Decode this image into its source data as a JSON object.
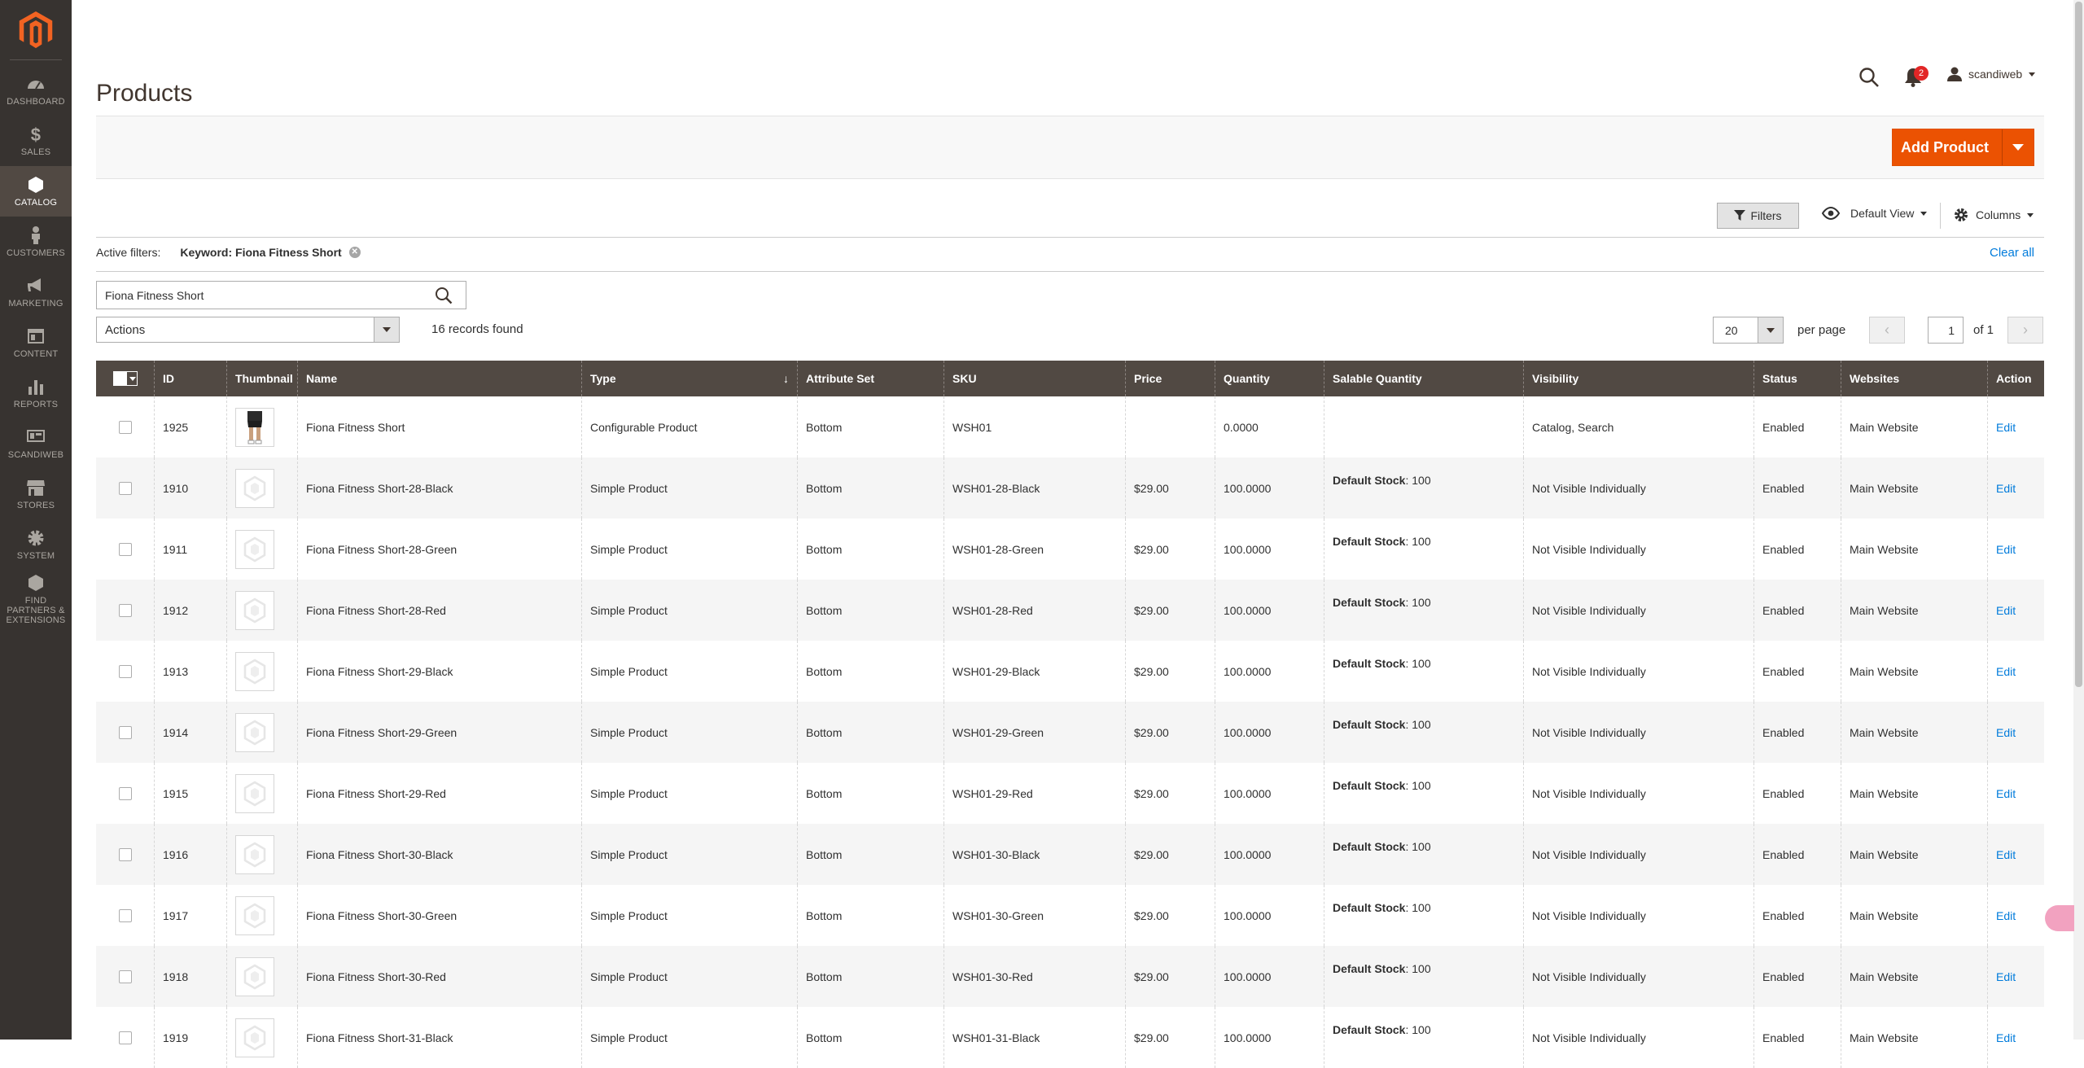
{
  "sidebar": {
    "items": [
      {
        "label": "DASHBOARD",
        "icon": "dashboard-icon"
      },
      {
        "label": "SALES",
        "icon": "dollar-icon"
      },
      {
        "label": "CATALOG",
        "icon": "box-icon",
        "active": true
      },
      {
        "label": "CUSTOMERS",
        "icon": "person-icon"
      },
      {
        "label": "MARKETING",
        "icon": "megaphone-icon"
      },
      {
        "label": "CONTENT",
        "icon": "layout-icon"
      },
      {
        "label": "REPORTS",
        "icon": "bar-chart-icon"
      },
      {
        "label": "SCANDIWEB",
        "icon": "monitor-icon"
      },
      {
        "label": "STORES",
        "icon": "store-icon"
      },
      {
        "label": "SYSTEM",
        "icon": "gear-icon"
      },
      {
        "label": "FIND PARTNERS & EXTENSIONS",
        "icon": "cube-icon"
      }
    ]
  },
  "header": {
    "title": "Products",
    "notifications_count": "2",
    "username": "scandiweb"
  },
  "toolbar": {
    "add_product_label": "Add Product",
    "filters_label": "Filters",
    "view_label": "Default View",
    "columns_label": "Columns",
    "active_filters_label": "Active filters:",
    "active_filter_chip": "Keyword: Fiona Fitness Short",
    "clear_all_label": "Clear all",
    "search_value": "Fiona Fitness Short",
    "actions_label": "Actions",
    "records_found": "16 records found",
    "per_page_value": "20",
    "per_page_label": "per page",
    "page_value": "1",
    "page_of": "of 1"
  },
  "colors": {
    "sidebar_bg": "#373330",
    "accent": "#eb5202",
    "grid_header": "#514943",
    "link": "#007bdb"
  },
  "grid": {
    "columns": [
      "ID",
      "Thumbnail",
      "Name",
      "Type",
      "Attribute Set",
      "SKU",
      "Price",
      "Quantity",
      "Salable Quantity",
      "Visibility",
      "Status",
      "Websites",
      "Action"
    ],
    "rows": [
      {
        "id": "1925",
        "name": "Fiona Fitness Short",
        "type": "Configurable Product",
        "attr": "Bottom",
        "sku": "WSH01",
        "price": "",
        "qty": "0.0000",
        "salable_label": "",
        "salable_value": "",
        "visibility": "Catalog, Search",
        "status": "Enabled",
        "website": "Main Website",
        "action": "Edit"
      },
      {
        "id": "1910",
        "name": "Fiona Fitness Short-28-Black",
        "type": "Simple Product",
        "attr": "Bottom",
        "sku": "WSH01-28-Black",
        "price": "$29.00",
        "qty": "100.0000",
        "salable_label": "Default Stock",
        "salable_value": ": 100",
        "visibility": "Not Visible Individually",
        "status": "Enabled",
        "website": "Main Website",
        "action": "Edit"
      },
      {
        "id": "1911",
        "name": "Fiona Fitness Short-28-Green",
        "type": "Simple Product",
        "attr": "Bottom",
        "sku": "WSH01-28-Green",
        "price": "$29.00",
        "qty": "100.0000",
        "salable_label": "Default Stock",
        "salable_value": ": 100",
        "visibility": "Not Visible Individually",
        "status": "Enabled",
        "website": "Main Website",
        "action": "Edit"
      },
      {
        "id": "1912",
        "name": "Fiona Fitness Short-28-Red",
        "type": "Simple Product",
        "attr": "Bottom",
        "sku": "WSH01-28-Red",
        "price": "$29.00",
        "qty": "100.0000",
        "salable_label": "Default Stock",
        "salable_value": ": 100",
        "visibility": "Not Visible Individually",
        "status": "Enabled",
        "website": "Main Website",
        "action": "Edit"
      },
      {
        "id": "1913",
        "name": "Fiona Fitness Short-29-Black",
        "type": "Simple Product",
        "attr": "Bottom",
        "sku": "WSH01-29-Black",
        "price": "$29.00",
        "qty": "100.0000",
        "salable_label": "Default Stock",
        "salable_value": ": 100",
        "visibility": "Not Visible Individually",
        "status": "Enabled",
        "website": "Main Website",
        "action": "Edit"
      },
      {
        "id": "1914",
        "name": "Fiona Fitness Short-29-Green",
        "type": "Simple Product",
        "attr": "Bottom",
        "sku": "WSH01-29-Green",
        "price": "$29.00",
        "qty": "100.0000",
        "salable_label": "Default Stock",
        "salable_value": ": 100",
        "visibility": "Not Visible Individually",
        "status": "Enabled",
        "website": "Main Website",
        "action": "Edit"
      },
      {
        "id": "1915",
        "name": "Fiona Fitness Short-29-Red",
        "type": "Simple Product",
        "attr": "Bottom",
        "sku": "WSH01-29-Red",
        "price": "$29.00",
        "qty": "100.0000",
        "salable_label": "Default Stock",
        "salable_value": ": 100",
        "visibility": "Not Visible Individually",
        "status": "Enabled",
        "website": "Main Website",
        "action": "Edit"
      },
      {
        "id": "1916",
        "name": "Fiona Fitness Short-30-Black",
        "type": "Simple Product",
        "attr": "Bottom",
        "sku": "WSH01-30-Black",
        "price": "$29.00",
        "qty": "100.0000",
        "salable_label": "Default Stock",
        "salable_value": ": 100",
        "visibility": "Not Visible Individually",
        "status": "Enabled",
        "website": "Main Website",
        "action": "Edit"
      },
      {
        "id": "1917",
        "name": "Fiona Fitness Short-30-Green",
        "type": "Simple Product",
        "attr": "Bottom",
        "sku": "WSH01-30-Green",
        "price": "$29.00",
        "qty": "100.0000",
        "salable_label": "Default Stock",
        "salable_value": ": 100",
        "visibility": "Not Visible Individually",
        "status": "Enabled",
        "website": "Main Website",
        "action": "Edit"
      },
      {
        "id": "1918",
        "name": "Fiona Fitness Short-30-Red",
        "type": "Simple Product",
        "attr": "Bottom",
        "sku": "WSH01-30-Red",
        "price": "$29.00",
        "qty": "100.0000",
        "salable_label": "Default Stock",
        "salable_value": ": 100",
        "visibility": "Not Visible Individually",
        "status": "Enabled",
        "website": "Main Website",
        "action": "Edit"
      },
      {
        "id": "1919",
        "name": "Fiona Fitness Short-31-Black",
        "type": "Simple Product",
        "attr": "Bottom",
        "sku": "WSH01-31-Black",
        "price": "$29.00",
        "qty": "100.0000",
        "salable_label": "Default Stock",
        "salable_value": ": 100",
        "visibility": "Not Visible Individually",
        "status": "Enabled",
        "website": "Main Website",
        "action": "Edit"
      }
    ]
  }
}
